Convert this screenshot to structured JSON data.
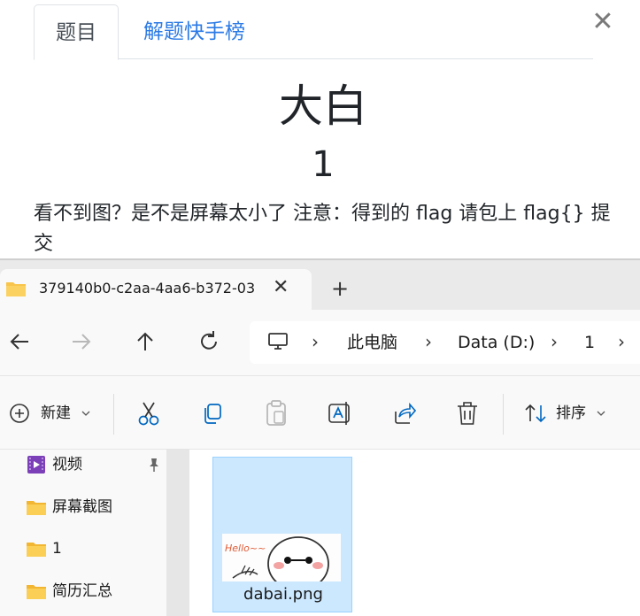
{
  "modal": {
    "tabs": [
      {
        "label": "题目",
        "active": true
      },
      {
        "label": "解题快手榜",
        "active": false
      }
    ],
    "close_label": "✕",
    "title": "大白",
    "points": "1",
    "description": "看不到图？是不是屏幕太小了 注意：得到的 flag 请包上 flag{} 提交"
  },
  "explorer": {
    "tab": {
      "title": "379140b0-c2aa-4aa6-b372-03",
      "close_label": "✕",
      "new_tab_label": "+"
    },
    "nav": {
      "back_icon": "arrow-left-icon",
      "forward_icon": "arrow-right-icon",
      "up_icon": "arrow-up-icon",
      "refresh_icon": "refresh-icon",
      "breadcrumb": [
        "此电脑",
        "Data (D:)",
        "1"
      ]
    },
    "toolbar": {
      "new_label": "新建",
      "sort_label": "排序",
      "icons": [
        "cut-icon",
        "copy-icon",
        "paste-icon",
        "rename-icon",
        "share-icon",
        "delete-icon"
      ]
    },
    "sidebar": {
      "items": [
        {
          "label": "视频",
          "icon": "video-folder-icon",
          "pinned": true
        },
        {
          "label": "屏幕截图",
          "icon": "folder-icon",
          "pinned": false
        },
        {
          "label": "1",
          "icon": "folder-icon",
          "pinned": false
        },
        {
          "label": "简历汇总",
          "icon": "folder-icon",
          "pinned": false
        }
      ]
    },
    "files": [
      {
        "name": "dabai.png",
        "selected": true,
        "thumb_text": "Hello~~"
      }
    ]
  },
  "colors": {
    "link_blue": "#2c7be5",
    "selection_fill": "#cce8ff",
    "folder_yellow": "#f8c44b",
    "accent_blue": "#0067c0"
  }
}
